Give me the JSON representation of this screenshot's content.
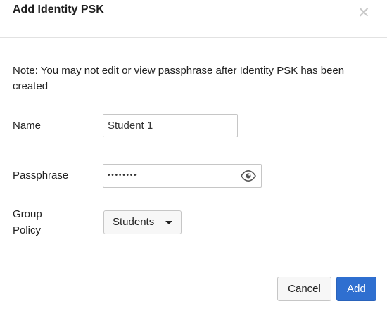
{
  "dialog": {
    "title": "Add Identity PSK",
    "close_icon": "close-icon"
  },
  "note": "Note: You may not edit or view passphrase after Identity PSK has been created",
  "form": {
    "name_label": "Name",
    "name_value": "Student 1",
    "passphrase_label": "Passphrase",
    "passphrase_masked": "••••••••",
    "passphrase_icon": "eye-icon",
    "group_policy_label_line1": "Group",
    "group_policy_label_line2": "Policy",
    "group_policy_selected": "Students"
  },
  "footer": {
    "cancel_label": "Cancel",
    "add_label": "Add"
  },
  "colors": {
    "primary": "#2f6fd0",
    "border": "#c6c6c6",
    "divider": "#e2e2e2",
    "close_icon": "#c8c8c8"
  }
}
